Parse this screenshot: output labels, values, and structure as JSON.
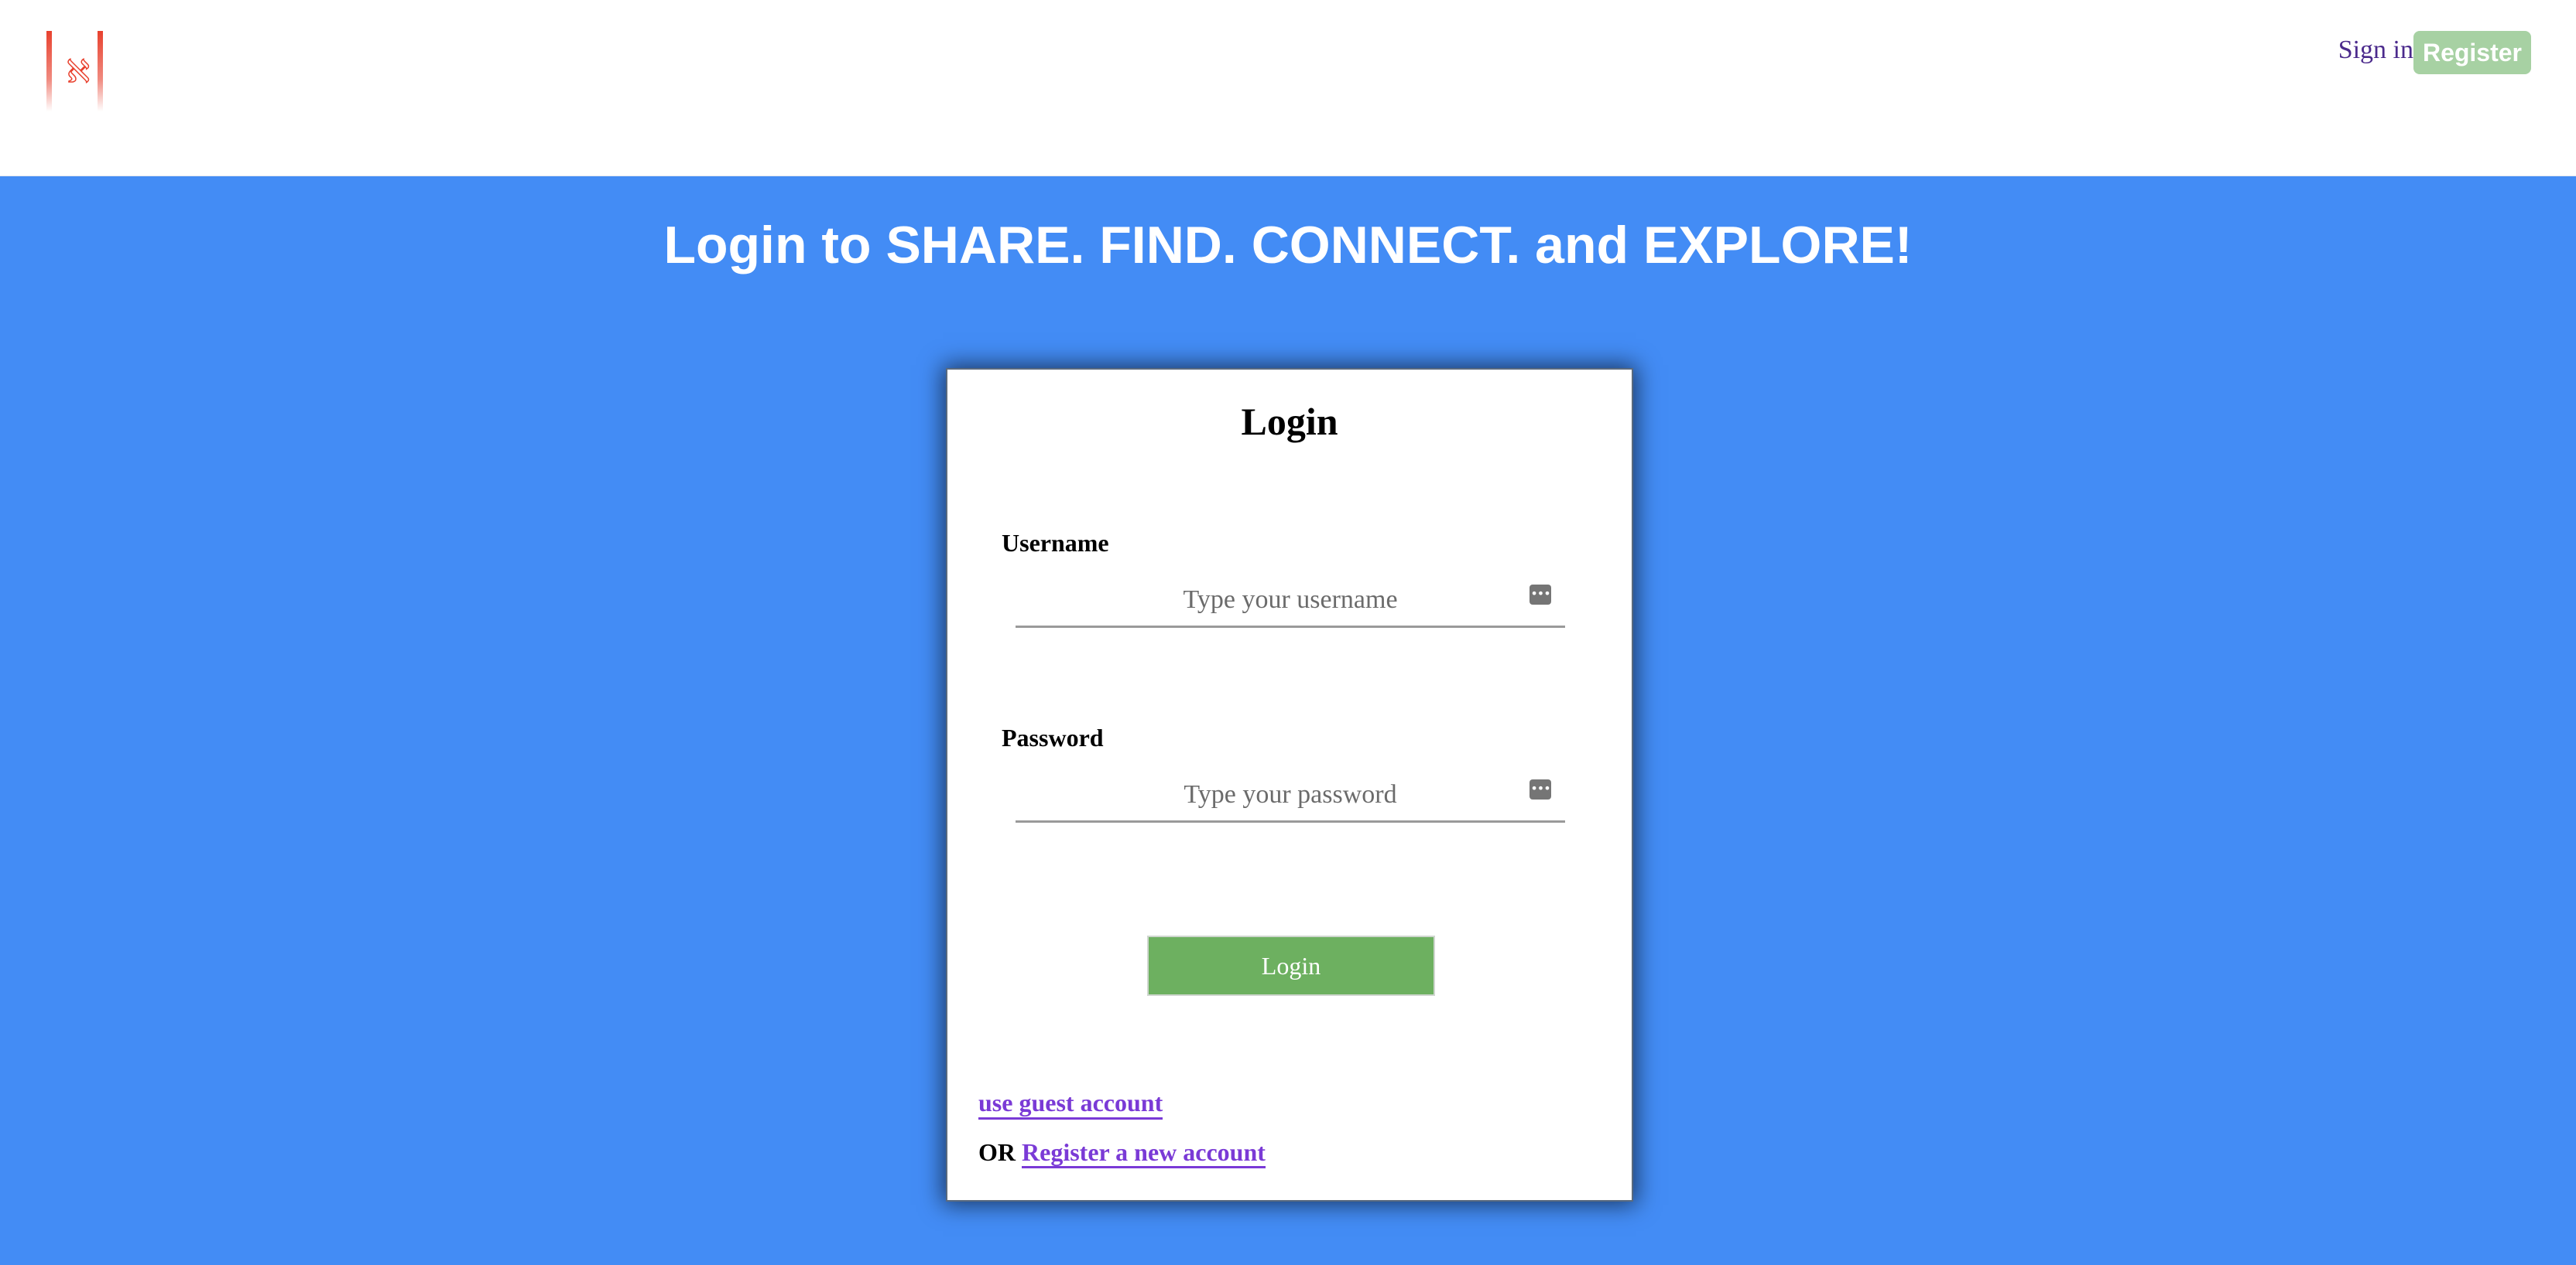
{
  "header": {
    "logo_glyph": "ℵ",
    "signin_label": "Sign in",
    "register_label": "Register"
  },
  "hero": {
    "headline": "Login to SHARE. FIND. CONNECT. and EXPLORE!"
  },
  "login_card": {
    "title": "Login",
    "username": {
      "label": "Username",
      "placeholder": "Type your username",
      "value": ""
    },
    "password": {
      "label": "Password",
      "placeholder": "Type your password",
      "value": ""
    },
    "submit_label": "Login",
    "guest_link": "use guest account",
    "or_text": "OR",
    "register_link": "Register a new account"
  },
  "colors": {
    "background": "#438cf5",
    "login_button": "#6db060",
    "register_button": "#a7d1a3",
    "link": "#7a3ad6",
    "logo": "#e8412e"
  },
  "icons": {
    "logo": "brand-logo-icon",
    "field_key": "password-manager-key-icon"
  }
}
